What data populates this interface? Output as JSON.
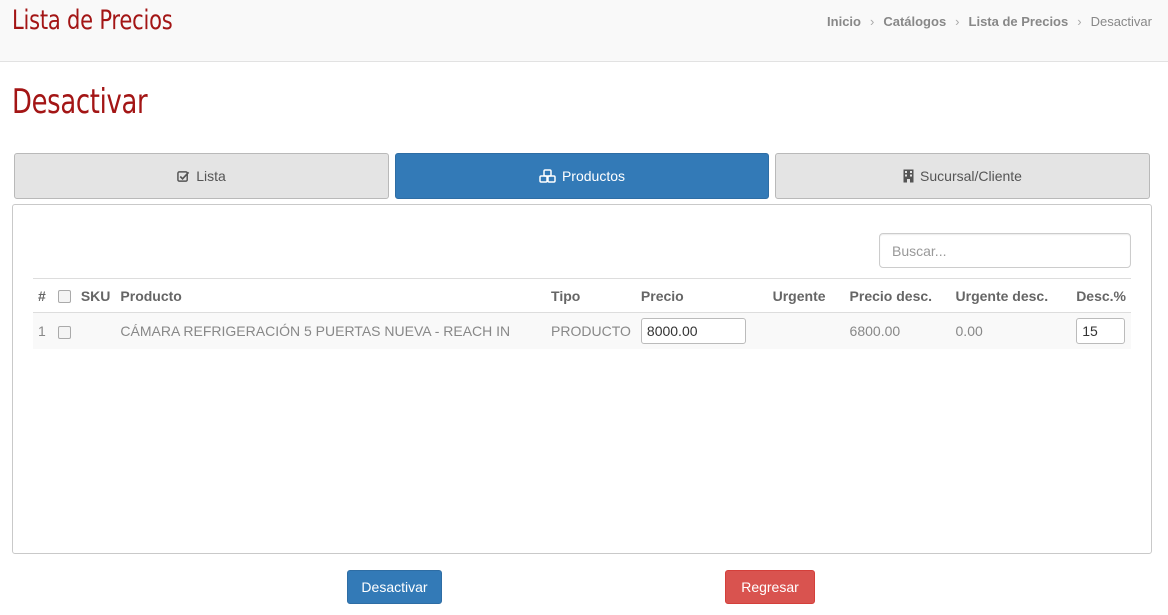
{
  "header": {
    "app_title": "Lista de Precios",
    "breadcrumb": [
      "Inicio",
      "Catálogos",
      "Lista de Precios",
      "Desactivar"
    ]
  },
  "page": {
    "title": "Desactivar"
  },
  "tabs": [
    {
      "label": "Lista",
      "icon": "check-square-icon",
      "active": false
    },
    {
      "label": "Productos",
      "icon": "cubes-icon",
      "active": true
    },
    {
      "label": "Sucursal/Cliente",
      "icon": "building-icon",
      "active": false
    }
  ],
  "search": {
    "placeholder": "Buscar..."
  },
  "table": {
    "headers": {
      "num": "#",
      "sku": "SKU",
      "producto": "Producto",
      "tipo": "Tipo",
      "precio": "Precio",
      "urgente": "Urgente",
      "precio_desc": "Precio desc.",
      "urgente_desc": "Urgente desc.",
      "desc_pct": "Desc.%"
    },
    "rows": [
      {
        "num": "1",
        "sku": "",
        "producto": "CÁMARA REFRIGERACIÓN 5 PUERTAS NUEVA - REACH IN",
        "tipo": "PRODUCTO",
        "precio": "8000.00",
        "urgente": "",
        "precio_desc": "6800.00",
        "urgente_desc": "0.00",
        "desc_pct": "15"
      }
    ]
  },
  "actions": {
    "deactivate_label": "Desactivar",
    "back_label": "Regresar"
  },
  "colors": {
    "brand": "#a31515",
    "primary": "#337ab7",
    "danger": "#d9534f"
  }
}
